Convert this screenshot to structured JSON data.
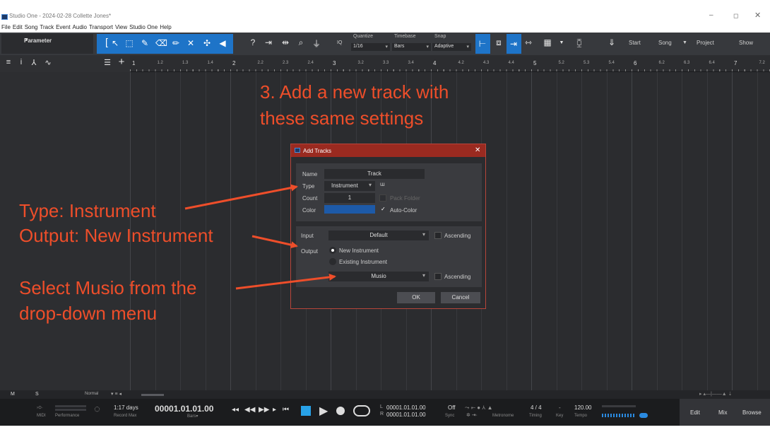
{
  "window": {
    "title": "Studio One - 2024-02-28 Collette Jones*",
    "minimize_glyph": "–",
    "maximize_glyph": "◻",
    "close_glyph": "✕"
  },
  "menu": [
    "File",
    "Edit",
    "Song",
    "Track",
    "Event",
    "Audio",
    "Transport",
    "View",
    "Studio One",
    "Help"
  ],
  "toolbar": {
    "parameter_label": "Parameter",
    "help_glyph": "?",
    "iq_label": "IQ",
    "quantize_label": "Quantize",
    "quantize_value": "1/16",
    "timebase_label": "Timebase",
    "timebase_value": "Bars",
    "snap_label": "Snap",
    "snap_value": "Adaptive",
    "start_label": "Start",
    "song_label": "Song",
    "project_label": "Project",
    "show_label": "Show"
  },
  "ruler": {
    "ticks": [
      "1",
      "1.2",
      "1.3",
      "1.4",
      "2",
      "2.2",
      "2.3",
      "2.4",
      "3",
      "3.2",
      "3.3",
      "3.4",
      "4",
      "4.2",
      "4.3",
      "4.4",
      "5",
      "5.2",
      "5.3",
      "5.4",
      "6",
      "6.2",
      "6.3",
      "6.4",
      "7",
      "7.2"
    ]
  },
  "dialog": {
    "title": "Add Tracks",
    "name_label": "Name",
    "name_value": "Track",
    "type_label": "Type",
    "type_value": "Instrument",
    "count_label": "Count",
    "count_value": "1",
    "pack_folder_label": "Pack Folder",
    "color_label": "Color",
    "color_value": "#1d5aa8",
    "auto_color_label": "Auto-Color",
    "input_label": "Input",
    "input_value": "Default",
    "ascending_label": "Ascending",
    "output_label": "Output",
    "new_instrument_label": "New Instrument",
    "existing_instrument_label": "Existing Instrument",
    "instrument_value": "Musio",
    "ascending2_label": "Ascending",
    "ok_label": "OK",
    "cancel_label": "Cancel"
  },
  "annotations": {
    "step3_line1": "3. Add a new track with",
    "step3_line2": "these same settings",
    "type_line": "Type: Instrument",
    "output_line": "Output: New Instrument",
    "musio_line1": "Select Musio from the",
    "musio_line2": "drop-down menu",
    "color": "#ee4e2a"
  },
  "bottom": {
    "m_label": "M",
    "s_label": "S",
    "normal_label": "Normal"
  },
  "transport": {
    "midi_label": "MIDI",
    "performance_label": "Performance",
    "days_value": "1:17 days",
    "record_max_label": "Record Max",
    "position_value": "00001.01.01.00",
    "bars_label": "Bars▾",
    "left_label": "L",
    "left_value": "00001.01.01.00",
    "right_label": "R",
    "right_value": "00001.01.01.00",
    "sync_value": "Off",
    "sync_label": "Sync",
    "metronome_label": "Metronome",
    "timing_value": "4 / 4",
    "timing_label": "Timing",
    "key_value": "-",
    "key_label": "Key",
    "tempo_value": "120.00",
    "tempo_label": "Tempo",
    "edit_label": "Edit",
    "mix_label": "Mix",
    "browse_label": "Browse"
  }
}
